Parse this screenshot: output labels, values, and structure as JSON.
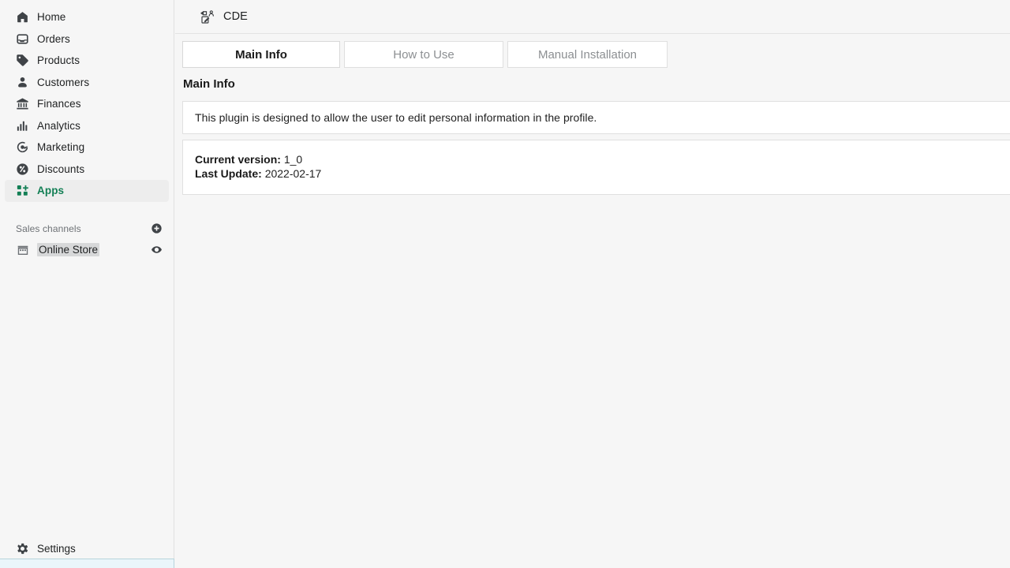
{
  "app": {
    "bg_color": "#f6f6f6",
    "accent_color": "#137f55"
  },
  "sidebar": {
    "items": [
      {
        "label": "Home",
        "icon": "home-icon",
        "active": false
      },
      {
        "label": "Orders",
        "icon": "orders-inbox-icon",
        "active": false
      },
      {
        "label": "Products",
        "icon": "product-tag-icon",
        "active": false
      },
      {
        "label": "Customers",
        "icon": "customer-person-icon",
        "active": false
      },
      {
        "label": "Finances",
        "icon": "finances-bank-icon",
        "active": false
      },
      {
        "label": "Analytics",
        "icon": "analytics-bars-icon",
        "active": false
      },
      {
        "label": "Marketing",
        "icon": "marketing-target-icon",
        "active": false
      },
      {
        "label": "Discounts",
        "icon": "discount-percent-icon",
        "active": false
      },
      {
        "label": "Apps",
        "icon": "apps-grid-plus-icon",
        "active": true
      }
    ],
    "group": {
      "title": "Sales channels",
      "add_icon": "plus-circle-icon"
    },
    "channels": [
      {
        "label": "Online Store",
        "icon": "storefront-icon",
        "action_icon": "eye-icon",
        "selected": true
      }
    ],
    "footer": {
      "label": "Settings",
      "icon": "gear-icon"
    }
  },
  "header": {
    "icon": "plugin-profile-edit-icon",
    "title": "CDE"
  },
  "main": {
    "tabs": [
      {
        "label": "Main Info",
        "active": true
      },
      {
        "label": "How to Use",
        "active": false
      },
      {
        "label": "Manual Installation",
        "active": false
      }
    ],
    "section_title": "Main Info",
    "description": "This plugin is designed to allow the user to edit personal information in the profile.",
    "meta": [
      {
        "key": "Current version:",
        "value": "1_0"
      },
      {
        "key": "Last Update:",
        "value": "2022-02-17"
      }
    ]
  }
}
